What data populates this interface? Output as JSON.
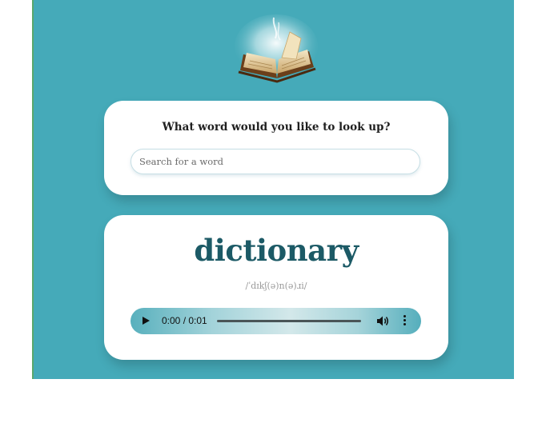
{
  "search": {
    "prompt": "What word would you like to look up?",
    "placeholder": "Search for a word",
    "value": ""
  },
  "result": {
    "word": "dictionary",
    "phonetic": "/ˈdɪkʃ(ə)n(ə)ɹi/"
  },
  "audio": {
    "time": "0:00 / 0:01",
    "progress": 0
  },
  "icons": {
    "logo": "open-book-logo",
    "play": "play-icon",
    "volume": "volume-icon",
    "more": "more-options-icon"
  },
  "colors": {
    "background": "#45aab9",
    "card": "#ffffff",
    "word": "#1c5a66"
  }
}
